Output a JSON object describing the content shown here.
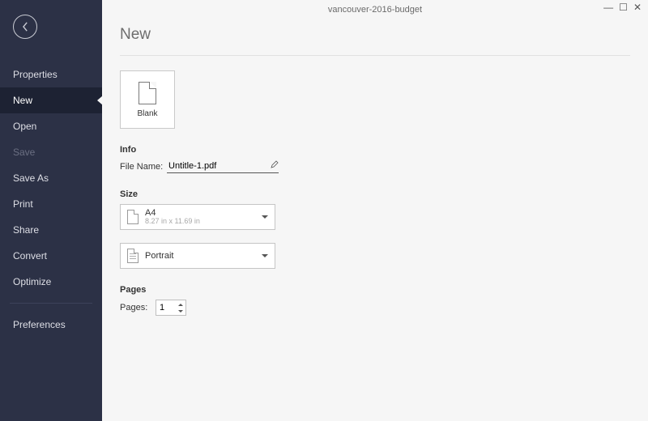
{
  "window": {
    "title": "vancouver-2016-budget"
  },
  "sidebar": {
    "items": [
      {
        "label": "Properties"
      },
      {
        "label": "New"
      },
      {
        "label": "Open"
      },
      {
        "label": "Save"
      },
      {
        "label": "Save As"
      },
      {
        "label": "Print"
      },
      {
        "label": "Share"
      },
      {
        "label": "Convert"
      },
      {
        "label": "Optimize"
      }
    ],
    "prefs_label": "Preferences",
    "selected_index": 1,
    "disabled_index": 3
  },
  "page": {
    "title": "New"
  },
  "template": {
    "label": "Blank"
  },
  "info": {
    "section": "Info",
    "filename_label": "File Name:",
    "filename_value": "Untitle-1.pdf"
  },
  "size": {
    "section": "Size",
    "paper_label": "A4",
    "paper_dims": "8.27 in x 11.69 in",
    "orientation": "Portrait"
  },
  "pages": {
    "section": "Pages",
    "label": "Pages:",
    "value": "1"
  }
}
